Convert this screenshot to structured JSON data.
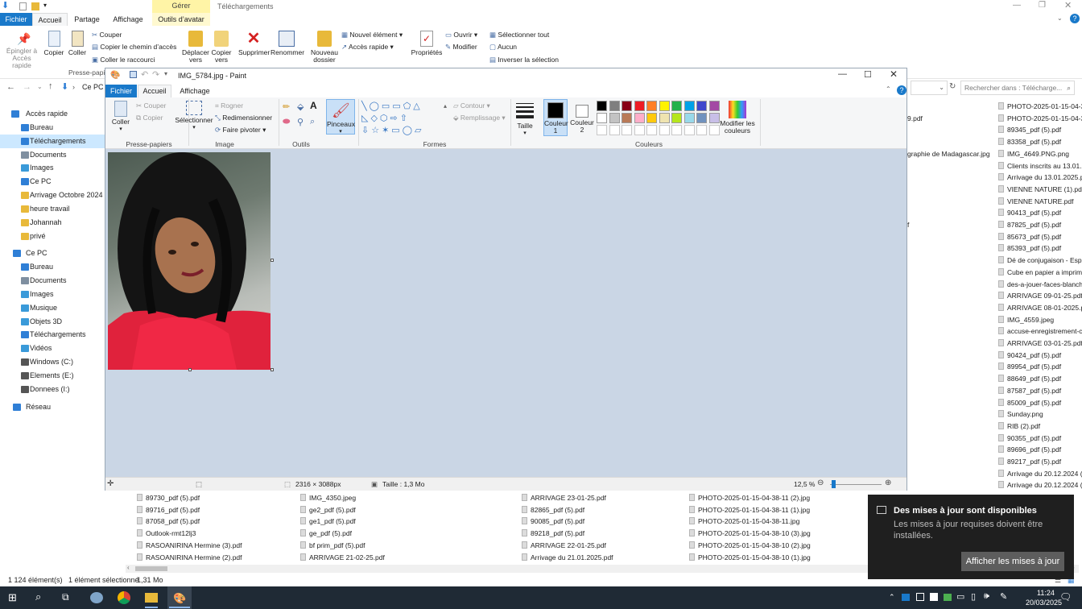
{
  "explorer": {
    "context_tab_top": "Gérer",
    "context_tab_window": "Téléchargements",
    "tabs": [
      "Fichier",
      "Accueil",
      "Partage",
      "Affichage",
      "Outils d’avatar"
    ],
    "ribbon": {
      "pin": "Épingler à\nAccès rapide",
      "copy": "Copier",
      "paste": "Coller",
      "cut": "Couper",
      "copy_path": "Copier le chemin d’accès",
      "paste_shortcut": "Coller le raccourci",
      "clipboard_group": "Presse-papie",
      "move_to": "Déplacer\nvers",
      "copy_to": "Copier\nvers",
      "delete": "Supprimer",
      "rename": "Renommer",
      "new_folder": "Nouveau\ndossier",
      "new_item": "Nouvel élément",
      "easy_access": "Accès rapide",
      "properties": "Propriétés",
      "open": "Ouvrir",
      "edit": "Modifier",
      "select_all": "Sélectionner tout",
      "select_none": "Aucun",
      "invert_selection": "Inverser la sélection"
    },
    "address_tail": "Ce PC",
    "search_placeholder": "Rechercher dans : Télécharge...",
    "nav_items": [
      {
        "label": "Accès rapide",
        "color": "#2f7fd6"
      },
      {
        "label": "Bureau",
        "color": "#2f7fd6"
      },
      {
        "label": "Téléchargements",
        "color": "#2f7fd6"
      },
      {
        "label": "Documents",
        "color": "#7f8fa0"
      },
      {
        "label": "Images",
        "color": "#3a9ad9"
      },
      {
        "label": "Ce PC",
        "color": "#2f7fd6"
      },
      {
        "label": "Arrivage Octobre 2024",
        "color": "#e8b93a"
      },
      {
        "label": "heure travail",
        "color": "#e8b93a"
      },
      {
        "label": "Johannah",
        "color": "#e8b93a"
      },
      {
        "label": "privé",
        "color": "#e8b93a"
      },
      {
        "label": "Ce PC",
        "color": "#2f7fd6"
      },
      {
        "label": "Bureau",
        "color": "#2f7fd6"
      },
      {
        "label": "Documents",
        "color": "#7f8fa0"
      },
      {
        "label": "Images",
        "color": "#3a9ad9"
      },
      {
        "label": "Musique",
        "color": "#3a9ad9"
      },
      {
        "label": "Objets 3D",
        "color": "#3a9ad9"
      },
      {
        "label": "Téléchargements",
        "color": "#2f7fd6"
      },
      {
        "label": "Vidéos",
        "color": "#3a9ad9"
      },
      {
        "label": "Windows (C:)",
        "color": "#555"
      },
      {
        "label": "Elements (E:)",
        "color": "#555"
      },
      {
        "label": "Donnees (I:)",
        "color": "#555"
      },
      {
        "label": "Réseau",
        "color": "#2f7fd6"
      }
    ],
    "partial_right": [
      "9.pdf",
      "graphie de Madagascar.jpg",
      "f"
    ],
    "right_files": [
      "PHOTO-2025-01-15-04-38-",
      "PHOTO-2025-01-15-04-38-",
      "89345_pdf (5).pdf",
      "83358_pdf (5).pdf",
      "IMG_4649.PNG.png",
      "Clients inscrits au 13.01.2",
      "Arrivage du 13.01.2025.pc",
      "VIENNE NATURE (1).pdf",
      "VIENNE NATURE.pdf",
      "90413_pdf (5).pdf",
      "87825_pdf (5).pdf",
      "85673_pdf (5).pdf",
      "85393_pdf (5).pdf",
      "Dé de conjugaison - Espa",
      "Cube en papier a imprime",
      "des-a-jouer-faces-blanch",
      "ARRIVAGE 09-01-25.pdf",
      "ARRIVAGE 08-01-2025.pdf",
      "IMG_4559.jpeg",
      "accuse-enregistrement-c",
      "ARRIVAGE 03-01-25.pdf",
      "90424_pdf (5).pdf",
      "89954_pdf (5).pdf",
      "88649_pdf (5).pdf",
      "87587_pdf (5).pdf",
      "85009_pdf (5).pdf",
      "Sunday.png",
      "RIB (2).pdf",
      "90355_pdf (5).pdf",
      "89696_pdf (5).pdf",
      "89217_pdf (5).pdf",
      "Arrivage du 20.12.2024 (9",
      "Arrivage du 20.12.2024 (7"
    ],
    "bottom_files": {
      "col1": [
        "89730_pdf (5).pdf",
        "89716_pdf (5).pdf",
        "87058_pdf (5).pdf",
        "Outlook-rmt12lj3",
        "RASOANIRINA Hermine (3).pdf",
        "RASOANIRINA Hermine (2).pdf"
      ],
      "col2": [
        "IMG_4350.jpeg",
        "ge2_pdf (5).pdf",
        "ge1_pdf (5).pdf",
        "ge_pdf (5).pdf",
        "bf prim_pdf (5).pdf",
        "ARRIVAGE 21-02-25.pdf"
      ],
      "col3": [
        "ARRIVAGE 23-01-25.pdf",
        "82865_pdf (5).pdf",
        "90085_pdf (5).pdf",
        "89218_pdf (5).pdf",
        "ARRIVAGE 22-01-25.pdf",
        "Arrivage du 21.01.2025.pdf"
      ],
      "col4": [
        "PHOTO-2025-01-15-04-38-11 (2).jpg",
        "PHOTO-2025-01-15-04-38-11 (1).jpg",
        "PHOTO-2025-01-15-04-38-11.jpg",
        "PHOTO-2025-01-15-04-38-10 (3).jpg",
        "PHOTO-2025-01-15-04-38-10 (2).jpg",
        "PHOTO-2025-01-15-04-38-10 (1).jpg"
      ]
    },
    "status": {
      "count": "1 124 élément(s)",
      "selected": "1 élément sélectionné",
      "size": "1,31 Mo"
    }
  },
  "paint": {
    "title": "IMG_5784.jpg - Paint",
    "tabs": [
      "Fichier",
      "Accueil",
      "Affichage"
    ],
    "ribbon": {
      "paste": "Coller",
      "cut": "Couper",
      "copy": "Copier",
      "clipboard_group": "Presse-papiers",
      "select": "Sélectionner",
      "crop": "Rogner",
      "resize": "Redimensionner",
      "rotate": "Faire pivoter",
      "image_group": "Image",
      "tools_group": "Outils",
      "brushes": "Pinceaux",
      "outline": "Contour",
      "fill": "Remplissage",
      "shapes_group": "Formes",
      "size": "Taille",
      "color1": "Couleur\n1",
      "color2": "Couleur\n2",
      "colors_group": "Couleurs",
      "edit_colors": "Modifier les\ncouleurs"
    },
    "palette_row1": [
      "#000000",
      "#7f7f7f",
      "#880015",
      "#ed1c24",
      "#ff7f27",
      "#fff200",
      "#22b14c",
      "#00a2e8",
      "#3f48cc",
      "#a349a4"
    ],
    "palette_row2": [
      "#ffffff",
      "#c3c3c3",
      "#b97a57",
      "#ffaec9",
      "#ffc90e",
      "#efe4b0",
      "#b5e61d",
      "#99d9ea",
      "#7092be",
      "#c8bfe7"
    ],
    "status": {
      "dimensions": "2316 × 3088px",
      "size": "Taille : 1,3 Mo",
      "zoom": "12,5 %"
    }
  },
  "notification": {
    "title": "Des mises à jour sont disponibles",
    "body": "Les mises à jour requises doivent être installées.",
    "button": "Afficher les mises à jour"
  },
  "taskbar": {
    "time": "11:24",
    "date": "20/03/2025"
  }
}
